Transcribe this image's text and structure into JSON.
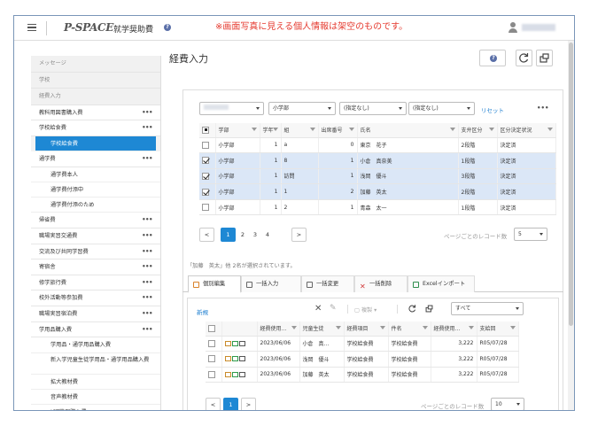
{
  "header": {
    "logo": "P-SPACE",
    "app_title": "就学奨助費",
    "notice": "※画面写真に見える個人情報は架空のものです。"
  },
  "sidebar": {
    "sections": [
      "メッセージ",
      "学校",
      "経費入力"
    ],
    "items": [
      {
        "label": "教科用図書購入費",
        "dots": "•••"
      },
      {
        "label": "学校給食費",
        "dots": "•••"
      },
      {
        "label": "学校給食費",
        "active": true
      },
      {
        "label": "通学費",
        "dots": "•••"
      },
      {
        "label": "通学費本人"
      },
      {
        "label": "通学費付添中"
      },
      {
        "label": "通学費付添のため"
      },
      {
        "label": "帰省費",
        "dots": "•••"
      },
      {
        "label": "職場実習交通費",
        "dots": "•••"
      },
      {
        "label": "交流及び共同学習費",
        "dots": "•••"
      },
      {
        "label": "寄宿舎",
        "dots": "•••"
      },
      {
        "label": "修学旅行費",
        "dots": "•••"
      },
      {
        "label": "校外活動等参加費",
        "dots": "•••"
      },
      {
        "label": "職場実習宿泊費",
        "dots": "•••"
      },
      {
        "label": "学用品購入費",
        "dots": "•••"
      },
      {
        "label": "学用品・通学用品購入費"
      },
      {
        "label": "新入学児童生徒学用品・通学用品購入費"
      },
      {
        "label": "拡大教材費"
      },
      {
        "label": "音声教材費"
      },
      {
        "label": "ICT機器購入費"
      }
    ]
  },
  "main": {
    "title": "経費入力",
    "help_icon": "question-icon",
    "refresh_icon": "refresh-icon",
    "window_icon": "window-icon",
    "filters": [
      "",
      "小学部",
      "(指定なし)",
      "(指定なし)"
    ],
    "reset_label": "リセット",
    "more_label": "•••",
    "table": {
      "columns": [
        "学部",
        "学年",
        "組",
        "出席番号",
        "氏名",
        "支弁区分",
        "区分決定状況"
      ],
      "rows": [
        {
          "checked": false,
          "cells": [
            "小学部",
            "1",
            "a",
            "0",
            "東京　花子",
            "2段階",
            "決定済"
          ]
        },
        {
          "checked": true,
          "cells": [
            "小学部",
            "1",
            "8",
            "1",
            "小倉　真奈美",
            "1段階",
            "決定済"
          ]
        },
        {
          "checked": true,
          "cells": [
            "小学部",
            "1",
            "訪問",
            "1",
            "浅岡　優斗",
            "3段階",
            "決定済"
          ]
        },
        {
          "checked": true,
          "cells": [
            "小学部",
            "1",
            "1",
            "2",
            "加藤　英太",
            "2段階",
            "決定済"
          ]
        },
        {
          "checked": false,
          "cells": [
            "小学部",
            "1",
            "2",
            "1",
            "青森　太一",
            "1段階",
            "決定済"
          ]
        }
      ]
    },
    "pagination": {
      "prev": "<",
      "next": ">",
      "pages": [
        "1",
        "2",
        "3",
        "4"
      ],
      "current": "1",
      "per_page_label": "ページごとのレコード数",
      "per_page_value": "5"
    },
    "selection_note": "「加藤　英太」他 2名が選択されています。",
    "tabs": [
      {
        "label": "個別編集",
        "active": true
      },
      {
        "label": "一括入力"
      },
      {
        "label": "一括変更"
      },
      {
        "label": "一括削除"
      },
      {
        "label": "Excelインポート"
      }
    ],
    "sub": {
      "new_label": "新規",
      "copy_label": "複製",
      "scope_value": "すべて",
      "columns": [
        "",
        "経費使用...",
        "児童生徒",
        "経費項目",
        "件名",
        "経費使用...",
        "支給回"
      ],
      "rows": [
        [
          "",
          "2023/06/06",
          "小倉　真...",
          "学校給食費",
          "学校給食費",
          "3,222",
          "R05/07/28"
        ],
        [
          "",
          "2023/06/06",
          "浅岡　優斗",
          "学校給食費",
          "学校給食費",
          "3,222",
          "R05/07/28"
        ],
        [
          "",
          "2023/06/06",
          "加藤　英太",
          "学校給食費",
          "学校給食費",
          "3,222",
          "R05/07/28"
        ]
      ],
      "pagination": {
        "prev": "<",
        "next": ">",
        "page": "1",
        "per_page_label": "ページごとのレコード数",
        "per_page_value": "10"
      }
    }
  },
  "colors": {
    "accent": "#1e88d4",
    "notice": "#e53a2f",
    "selected_row": "#dbe7f7"
  }
}
